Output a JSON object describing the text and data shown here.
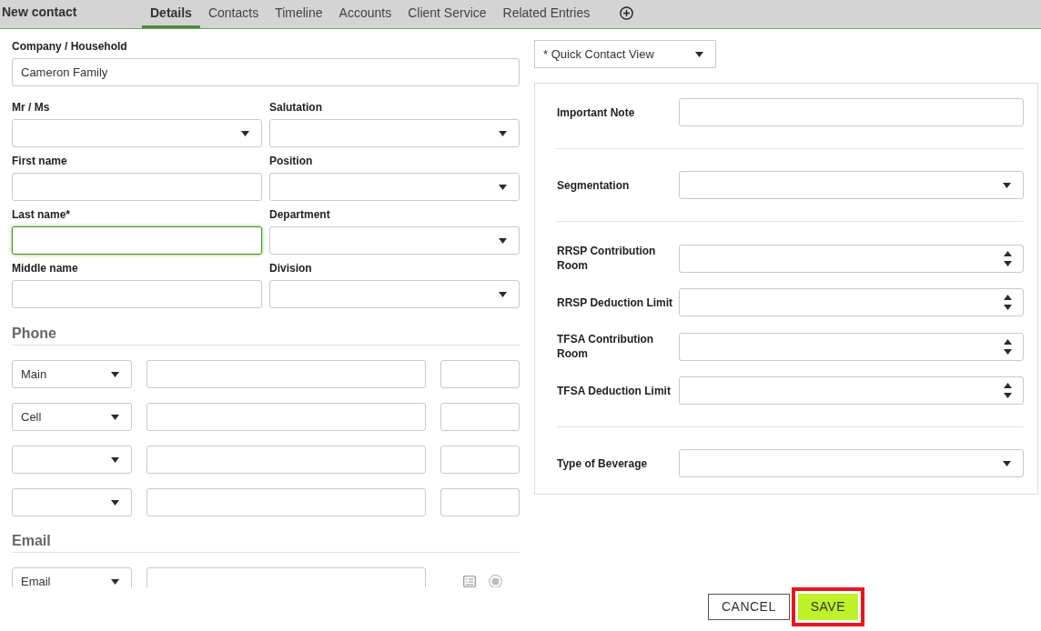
{
  "header": {
    "title": "New contact",
    "tabs": [
      {
        "label": "Details",
        "selected": true
      },
      {
        "label": "Contacts",
        "selected": false
      },
      {
        "label": "Timeline",
        "selected": false
      },
      {
        "label": "Accounts",
        "selected": false
      },
      {
        "label": "Client Service",
        "selected": false
      },
      {
        "label": "Related Entries",
        "selected": false
      }
    ]
  },
  "company": {
    "label": "Company / Household",
    "value": "Cameron Family"
  },
  "fields": [
    {
      "label": "Mr / Ms",
      "kind": "select",
      "focused": false
    },
    {
      "label": "Salutation",
      "kind": "select",
      "focused": false
    },
    {
      "label": "First name",
      "kind": "text",
      "focused": false
    },
    {
      "label": "Position",
      "kind": "select",
      "focused": false
    },
    {
      "label": "Last name*",
      "kind": "text",
      "focused": true
    },
    {
      "label": "Department",
      "kind": "select",
      "focused": false
    },
    {
      "label": "Middle name",
      "kind": "text",
      "focused": false
    },
    {
      "label": "Division",
      "kind": "select",
      "focused": false
    }
  ],
  "phone": {
    "title": "Phone",
    "rows": [
      {
        "type": "Main"
      },
      {
        "type": "Cell"
      },
      {},
      {}
    ]
  },
  "email": {
    "title": "Email",
    "rows": [
      {
        "type": "Email",
        "selected": true
      }
    ]
  },
  "quick_view": {
    "value": "* Quick Contact View"
  },
  "panel": {
    "groups": [
      {
        "fields": [
          {
            "label": "Important Note",
            "kind": "text"
          }
        ]
      },
      {
        "fields": [
          {
            "label": "Segmentation",
            "kind": "select"
          }
        ]
      },
      {
        "fields": [
          {
            "label": "RRSP Contribution Room",
            "kind": "number"
          },
          {
            "label": "RRSP Deduction Limit",
            "kind": "number"
          },
          {
            "label": "TFSA Contribution Room",
            "kind": "number"
          },
          {
            "label": "TFSA Deduction Limit",
            "kind": "number"
          }
        ]
      },
      {
        "fields": [
          {
            "label": "Type of Beverage",
            "kind": "select"
          }
        ]
      }
    ]
  },
  "footer": {
    "buttons": [
      {
        "label": "CANCEL",
        "kind": "secondary",
        "highlighted": false
      },
      {
        "label": "SAVE",
        "kind": "primary",
        "highlighted": true
      }
    ]
  }
}
